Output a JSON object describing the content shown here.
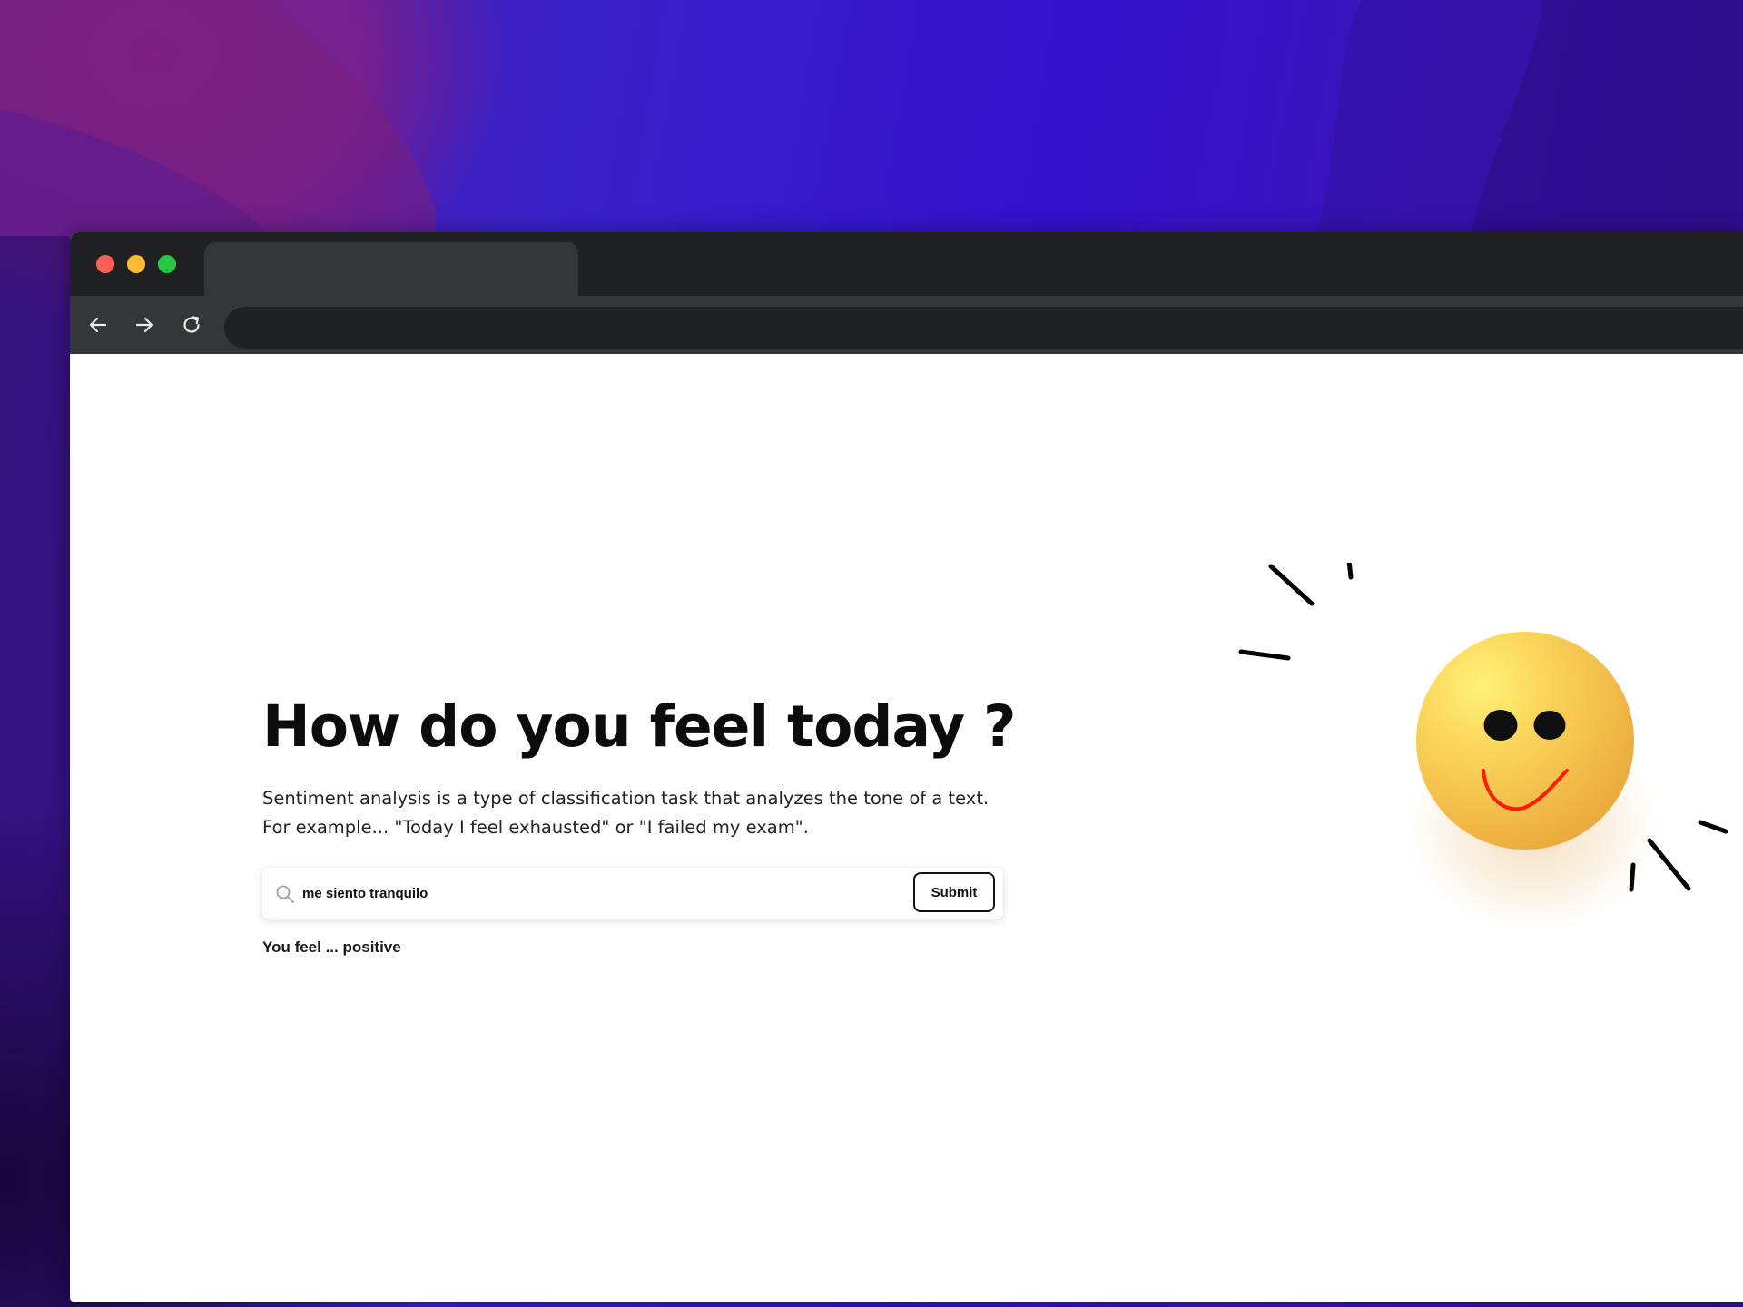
{
  "colors": {
    "traffic_close": "#ff5f57",
    "traffic_minimize": "#febc2e",
    "traffic_maximize": "#28c840",
    "titlebar": "#202124",
    "toolbar": "#35363a",
    "smiley": "#f7c948",
    "smile_stroke": "#ff1a00"
  },
  "browser": {
    "nav_icons": [
      "back-arrow-icon",
      "forward-arrow-icon",
      "reload-icon"
    ]
  },
  "main": {
    "headline": "How do you feel today ?",
    "description_line1": "Sentiment analysis is a type of classification task that analyzes the tone of a text.",
    "description_line2": "For example... \"Today I feel exhausted\" or \"I failed my exam\".",
    "search": {
      "value": "me siento tranquilo",
      "icon": "search-icon"
    },
    "submit_label": "Submit",
    "result_text": "You feel ... positive"
  }
}
